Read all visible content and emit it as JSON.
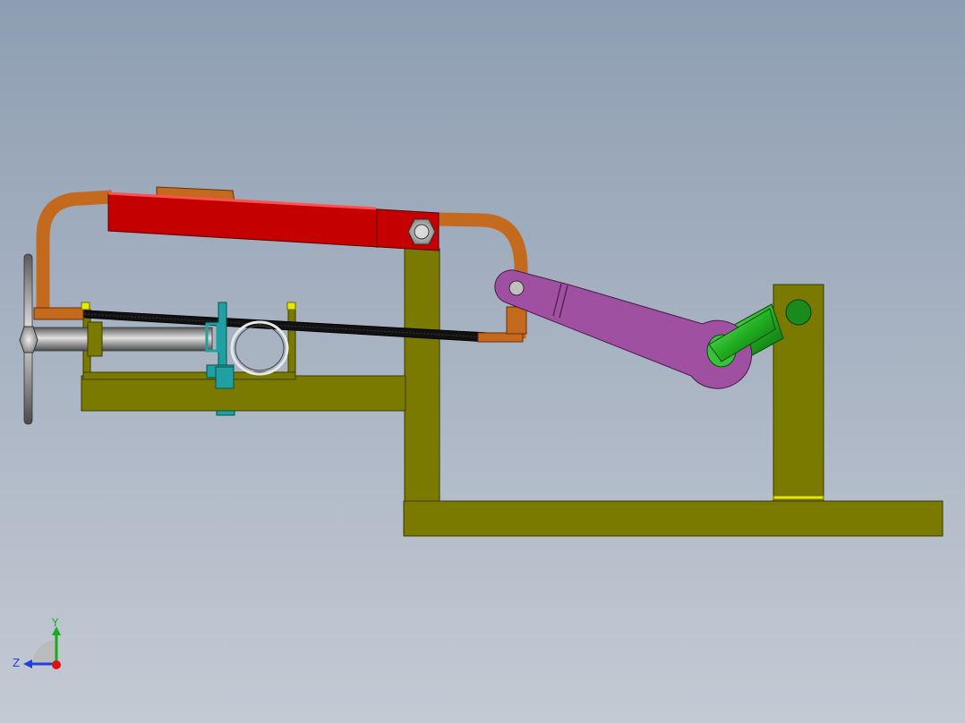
{
  "scene": {
    "background_top": "#8E9EB2",
    "background_bottom": "#C4CAD4"
  },
  "colors": {
    "frame_olive": "#7A7A00",
    "frame_edge": "#3A3A00",
    "saw_frame_copper": "#C46A1E",
    "saw_handle_red": "#C40000",
    "connecting_rod_purple": "#A050A0",
    "crank_shaft_green": "#2CB02C",
    "pivot_green": "#1A8A1A",
    "vise_jaw_teal": "#20A0A0",
    "clamp_screw_gray": "#8A8A8A",
    "blade_black": "#111111",
    "nut_yellow": "#E8E800"
  },
  "parts": [
    "base-plate",
    "vertical-post",
    "workpiece-table",
    "motor-support",
    "saw-frame",
    "saw-handle",
    "hacksaw-blade",
    "connecting-rod",
    "crank-shaft",
    "vise-jaw",
    "vise-screw",
    "workpiece-tube",
    "pivot-nut"
  ],
  "axis_triad": {
    "y_label": "Y",
    "z_label": "Z",
    "y_color": "#1AAA1A",
    "z_color": "#2040E0",
    "x_color": "#E01010"
  }
}
